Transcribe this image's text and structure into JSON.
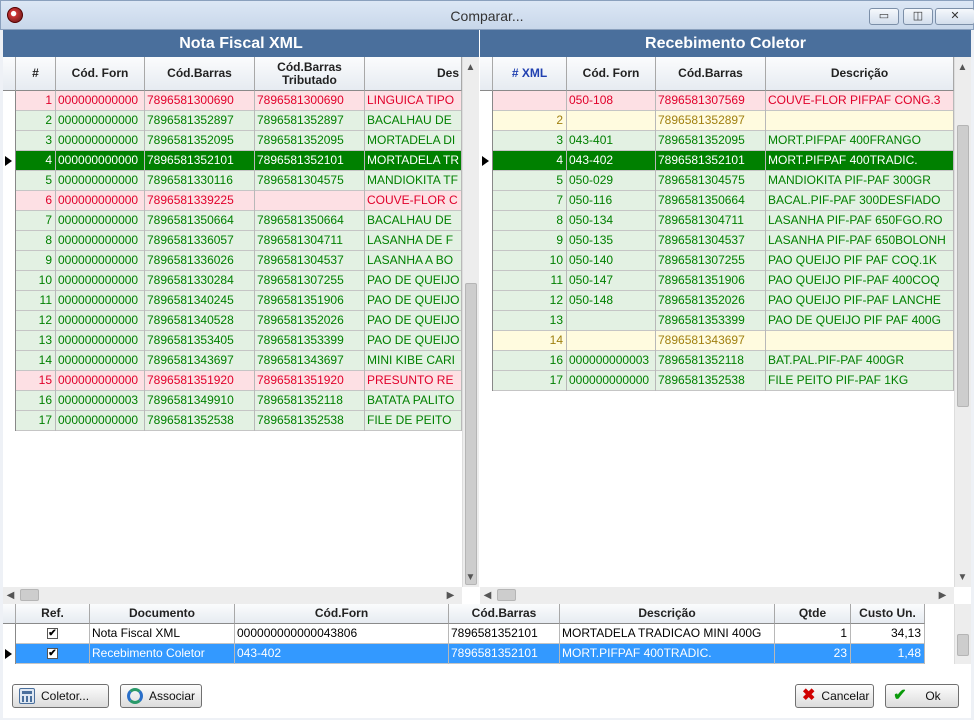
{
  "window": {
    "title": "Comparar...",
    "minimize": "▭",
    "restore": "◫",
    "close": "✕"
  },
  "colors": {
    "header": "#4a6f9c",
    "pink": "#fde0e4",
    "green": "#e3f1e3",
    "yellow": "#fffbdf",
    "selected": "#008000",
    "selectedBlue": "#3399ff",
    "redText": "#e0002a",
    "greenText": "#008000",
    "oliveText": "#a08010"
  },
  "left": {
    "title": "Nota Fiscal XML",
    "columns": [
      "#",
      "Cód. Forn",
      "Cód.Barras",
      "Cód.Barras Tributado",
      "Des"
    ],
    "rows": [
      {
        "n": "1",
        "forn": "000000000000",
        "barras": "7896581300690",
        "trib": "7896581300690",
        "desc": "LINGUICA TIPO",
        "status": "pink"
      },
      {
        "n": "2",
        "forn": "000000000000",
        "barras": "7896581352897",
        "trib": "7896581352897",
        "desc": "BACALHAU DE",
        "status": "green"
      },
      {
        "n": "3",
        "forn": "000000000000",
        "barras": "7896581352095",
        "trib": "7896581352095",
        "desc": "MORTADELA DI",
        "status": "green"
      },
      {
        "n": "4",
        "forn": "000000000000",
        "barras": "7896581352101",
        "trib": "7896581352101",
        "desc": "MORTADELA TR",
        "status": "selected"
      },
      {
        "n": "5",
        "forn": "000000000000",
        "barras": "7896581330116",
        "trib": "7896581304575",
        "desc": "MANDIOKITA TF",
        "status": "green"
      },
      {
        "n": "6",
        "forn": "000000000000",
        "barras": "7896581339225",
        "trib": "",
        "desc": "COUVE-FLOR C",
        "status": "pink"
      },
      {
        "n": "7",
        "forn": "000000000000",
        "barras": "7896581350664",
        "trib": "7896581350664",
        "desc": "BACALHAU DE",
        "status": "green"
      },
      {
        "n": "8",
        "forn": "000000000000",
        "barras": "7896581336057",
        "trib": "7896581304711",
        "desc": "LASANHA DE F",
        "status": "green"
      },
      {
        "n": "9",
        "forn": "000000000000",
        "barras": "7896581336026",
        "trib": "7896581304537",
        "desc": "LASANHA A BO",
        "status": "green"
      },
      {
        "n": "10",
        "forn": "000000000000",
        "barras": "7896581330284",
        "trib": "7896581307255",
        "desc": "PAO DE QUEIJO",
        "status": "green"
      },
      {
        "n": "11",
        "forn": "000000000000",
        "barras": "7896581340245",
        "trib": "7896581351906",
        "desc": "PAO DE QUEIJO",
        "status": "green"
      },
      {
        "n": "12",
        "forn": "000000000000",
        "barras": "7896581340528",
        "trib": "7896581352026",
        "desc": "PAO DE QUEIJO",
        "status": "green"
      },
      {
        "n": "13",
        "forn": "000000000000",
        "barras": "7896581353405",
        "trib": "7896581353399",
        "desc": "PAO DE QUEIJO",
        "status": "green"
      },
      {
        "n": "14",
        "forn": "000000000000",
        "barras": "7896581343697",
        "trib": "7896581343697",
        "desc": "MINI KIBE CARI",
        "status": "green"
      },
      {
        "n": "15",
        "forn": "000000000000",
        "barras": "7896581351920",
        "trib": "7896581351920",
        "desc": "PRESUNTO RE",
        "status": "pink"
      },
      {
        "n": "16",
        "forn": "000000000003",
        "barras": "7896581349910",
        "trib": "7896581352118",
        "desc": "BATATA PALITO",
        "status": "green"
      },
      {
        "n": "17",
        "forn": "000000000000",
        "barras": "7896581352538",
        "trib": "7896581352538",
        "desc": "FILE DE PEITO",
        "status": "green"
      }
    ]
  },
  "right": {
    "title": "Recebimento Coletor",
    "columns": [
      "# XML",
      "Cód. Forn",
      "Cód.Barras",
      "Descrição"
    ],
    "rows": [
      {
        "n": "",
        "forn": "050-108",
        "barras": "7896581307569",
        "desc": "COUVE-FLOR PIFPAF CONG.3",
        "status": "pink"
      },
      {
        "n": "2",
        "forn": "",
        "barras": "7896581352897",
        "desc": "",
        "status": "yellow"
      },
      {
        "n": "3",
        "forn": "043-401",
        "barras": "7896581352095",
        "desc": "MORT.PIFPAF 400FRANGO",
        "status": "green"
      },
      {
        "n": "4",
        "forn": "043-402",
        "barras": "7896581352101",
        "desc": "MORT.PIFPAF 400TRADIC.",
        "status": "selected"
      },
      {
        "n": "5",
        "forn": "050-029",
        "barras": "7896581304575",
        "desc": "MANDIOKITA PIF-PAF 300GR",
        "status": "green"
      },
      {
        "n": "7",
        "forn": "050-116",
        "barras": "7896581350664",
        "desc": "BACAL.PIF-PAF 300DESFIADO",
        "status": "green"
      },
      {
        "n": "8",
        "forn": "050-134",
        "barras": "7896581304711",
        "desc": "LASANHA PIF-PAF 650FGO.RO",
        "status": "green"
      },
      {
        "n": "9",
        "forn": "050-135",
        "barras": "7896581304537",
        "desc": "LASANHA PIF-PAF 650BOLONH",
        "status": "green"
      },
      {
        "n": "10",
        "forn": "050-140",
        "barras": "7896581307255",
        "desc": "PAO QUEIJO PIF PAF COQ.1K",
        "status": "green"
      },
      {
        "n": "11",
        "forn": "050-147",
        "barras": "7896581351906",
        "desc": "PAO QUEIJO PIF-PAF 400COQ",
        "status": "green"
      },
      {
        "n": "12",
        "forn": "050-148",
        "barras": "7896581352026",
        "desc": "PAO QUEIJO PIF-PAF LANCHE",
        "status": "green"
      },
      {
        "n": "13",
        "forn": "",
        "barras": "7896581353399",
        "desc": "PAO DE QUEIJO PIF PAF 400G",
        "status": "green"
      },
      {
        "n": "14",
        "forn": "",
        "barras": "7896581343697",
        "desc": "",
        "status": "yellow"
      },
      {
        "n": "16",
        "forn": "000000000003",
        "barras": "7896581352118",
        "desc": "BAT.PAL.PIF-PAF 400GR",
        "status": "green"
      },
      {
        "n": "17",
        "forn": "000000000000",
        "barras": "7896581352538",
        "desc": "FILE PEITO PIF-PAF 1KG",
        "status": "green"
      }
    ]
  },
  "bottom": {
    "columns": [
      "Ref.",
      "Documento",
      "Cód.Forn",
      "Cód.Barras",
      "Descrição",
      "Qtde",
      "Custo Un."
    ],
    "rows": [
      {
        "ref": "✔",
        "doc": "Nota Fiscal XML",
        "forn": "000000000000043806",
        "barras": "7896581352101",
        "desc": "MORTADELA TRADICAO MINI 400G",
        "qtde": "1",
        "custo": "34,13"
      },
      {
        "ref": "✔",
        "doc": "Recebimento Coletor",
        "forn": "043-402",
        "barras": "7896581352101",
        "desc": "MORT.PIFPAF 400TRADIC.",
        "qtde": "23",
        "custo": "1,48"
      }
    ]
  },
  "buttons": {
    "coletor": "Coletor...",
    "associar": "Associar",
    "cancelar": "Cancelar",
    "ok": "Ok"
  }
}
